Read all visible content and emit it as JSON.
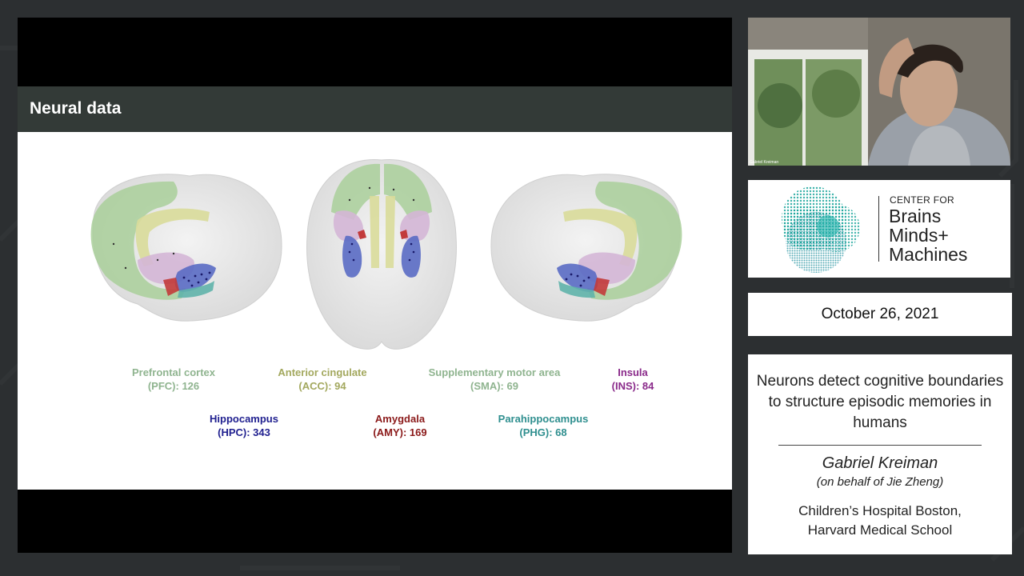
{
  "slide": {
    "title": "Neural data",
    "regions": [
      {
        "name": "Prefrontal cortex",
        "count_text": "(PFC): 126",
        "color": "#8fb48f"
      },
      {
        "name": "Anterior cingulate",
        "count_text": "(ACC): 94",
        "color": "#a3a85e"
      },
      {
        "name": "Supplementary motor area",
        "count_text": "(SMA): 69",
        "color": "#8fb48f"
      },
      {
        "name": "Insula",
        "count_text": "(INS): 84",
        "color": "#8a2a8a"
      },
      {
        "name": "Hippocampus",
        "count_text": "(HPC): 343",
        "color": "#1f1f8f"
      },
      {
        "name": "Amygdala",
        "count_text": "(AMY): 169",
        "color": "#8b1a1a"
      },
      {
        "name": "Parahippocampus",
        "count_text": "(PHG): 68",
        "color": "#2f8f8f"
      }
    ]
  },
  "webcam": {
    "participant_name": "Gabriel Kreiman"
  },
  "logo": {
    "line1": "CENTER FOR",
    "line2": "Brains",
    "line3": "Minds+",
    "line4": "Machines",
    "accent_color": "#1aa59b"
  },
  "event": {
    "date": "October 26, 2021"
  },
  "talk": {
    "title": "Neurons detect cognitive boundaries to structure episodic memories in humans",
    "speaker": "Gabriel Kreiman",
    "on_behalf": "(on behalf of Jie Zheng)",
    "affiliation_line1": "Children’s Hospital Boston,",
    "affiliation_line2": "Harvard Medical School"
  }
}
